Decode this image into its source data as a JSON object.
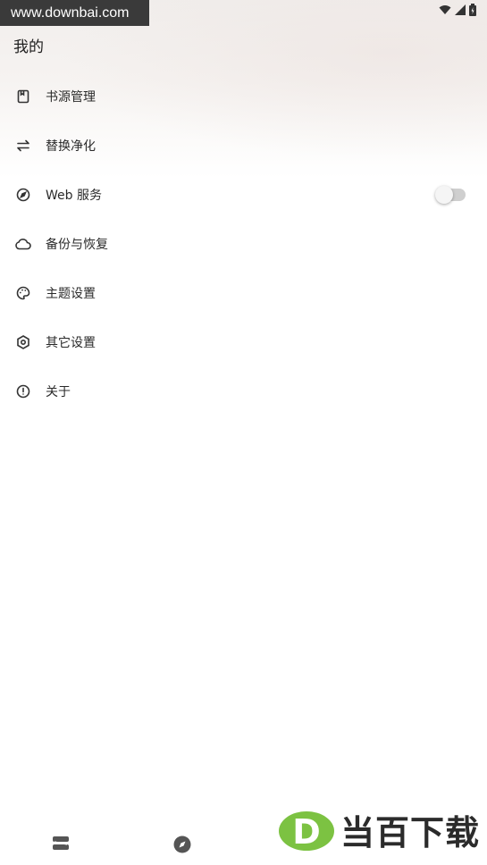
{
  "watermark": {
    "url": "www.downbai.com",
    "brand": "当百下载",
    "logo_letter": "D"
  },
  "status_bar": {
    "icons": [
      "wifi-icon",
      "signal-icon",
      "battery-charging-icon"
    ]
  },
  "header": {
    "title": "我的"
  },
  "menu": {
    "items": [
      {
        "label": "书源管理",
        "icon": "book-source-icon"
      },
      {
        "label": "替换净化",
        "icon": "swap-arrows-icon"
      },
      {
        "label": "Web 服务",
        "icon": "compass-icon",
        "toggle_on": false
      },
      {
        "label": "备份与恢复",
        "icon": "cloud-icon"
      },
      {
        "label": "主题设置",
        "icon": "palette-icon"
      },
      {
        "label": "其它设置",
        "icon": "settings-icon"
      },
      {
        "label": "关于",
        "icon": "info-icon"
      }
    ]
  },
  "bottom_nav": {
    "icons": [
      "bookshelf-icon",
      "explore-compass-icon"
    ]
  },
  "colors": {
    "brand_green": "#7cc242",
    "text": "#2a2a2a",
    "toggle_track": "#cfcfcf"
  }
}
